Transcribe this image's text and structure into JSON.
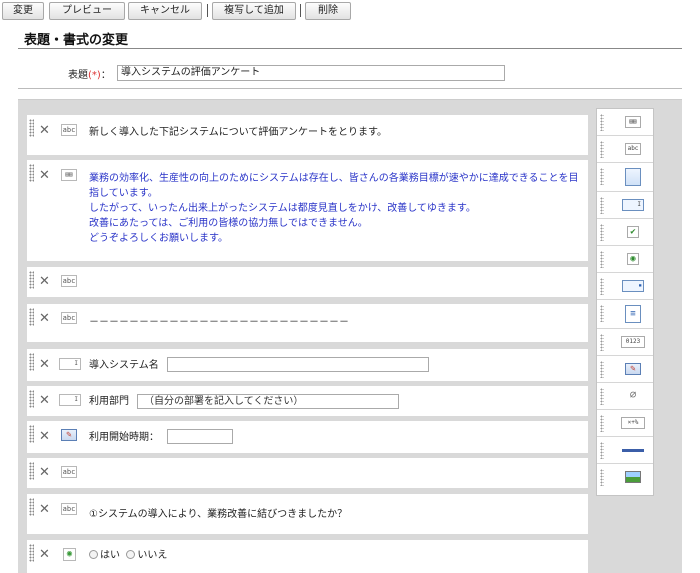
{
  "toolbar": {
    "change": "変更",
    "preview": "プレビュー",
    "cancel": "キャンセル",
    "copy_add": "複写して追加",
    "delete": "削除"
  },
  "header": {
    "page_title": "表題・書式の変更",
    "title_label": "表題",
    "required_mark": "(*)",
    "colon": "：",
    "title_value": "導入システムの評価アンケート"
  },
  "blocks": {
    "intro": {
      "icon": "abc",
      "text": "新しく導入した下記システムについて評価アンケートをとります。"
    },
    "message": {
      "icon": "rich-text-icon",
      "lines": [
        "業務の効率化、生産性の向上のためにシステムは存在し、皆さんの各業務目標が速やかに達成できることを目",
        "指しています。",
        "したがって、いったん出来上がったシステムは都度見直しをかけ、改善してゆきます。",
        "改善にあたっては、ご利用の皆様の協力無しではできません。",
        "どうぞよろしくお願いします。"
      ]
    },
    "blank1": {
      "icon": "abc"
    },
    "divider": {
      "icon": "abc",
      "text": "－－－－－－－－－－－－－－－－－－－－－－－－－－"
    },
    "system_name": {
      "label": "導入システム名",
      "value": ""
    },
    "department": {
      "label": "利用部門",
      "value": "（自分の部署を記入してください）"
    },
    "start_date": {
      "label": "利用開始時期：",
      "value": ""
    },
    "blank2": {
      "icon": "abc"
    },
    "question1": {
      "icon": "abc",
      "text": "①システムの導入により、業務改善に結びつきましたか？"
    },
    "answer1": {
      "option_yes": "はい",
      "option_no": "いいえ"
    }
  },
  "palette": {
    "items": [
      {
        "name": "rich-text",
        "icon": "▤"
      },
      {
        "name": "text-label",
        "icon": "abc"
      },
      {
        "name": "textarea",
        "icon": ""
      },
      {
        "name": "text-input",
        "icon": "I"
      },
      {
        "name": "checkbox",
        "icon": "✔"
      },
      {
        "name": "radio",
        "icon": "◉"
      },
      {
        "name": "select",
        "icon": "▾"
      },
      {
        "name": "list",
        "icon": "≡"
      },
      {
        "name": "number",
        "icon": "0123"
      },
      {
        "name": "date",
        "icon": "✎"
      },
      {
        "name": "attachment",
        "icon": "📎"
      },
      {
        "name": "calculation",
        "icon": "×+%"
      },
      {
        "name": "horizontal-rule",
        "icon": "—"
      },
      {
        "name": "image",
        "icon": "▣"
      }
    ]
  },
  "colors": {
    "accent_text": "#2a34c8",
    "required": "#dd3333",
    "canvas_bg": "#d9d9d9"
  }
}
